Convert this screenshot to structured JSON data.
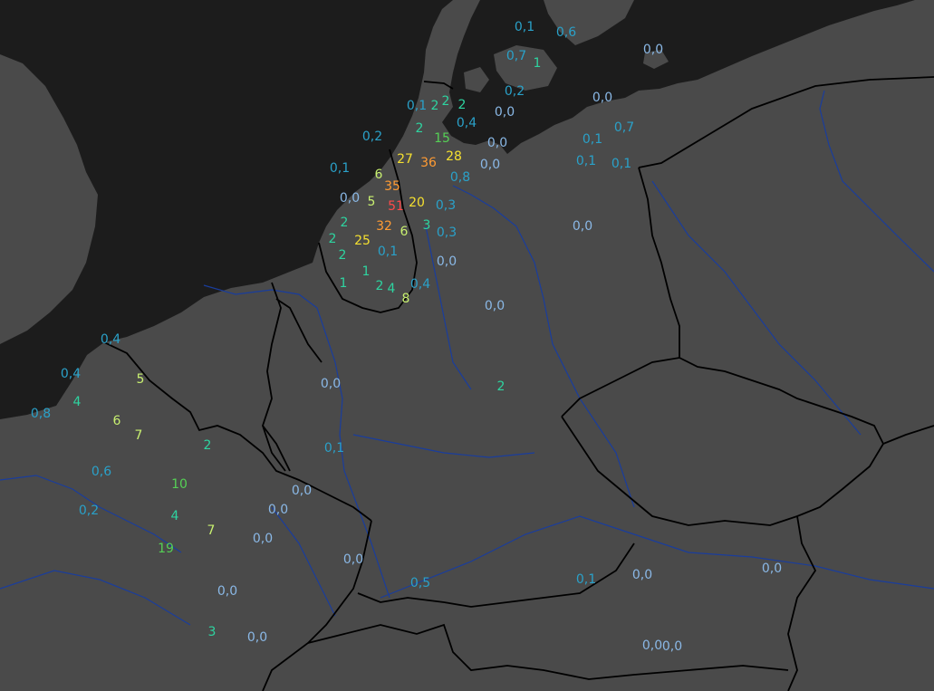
{
  "colors": {
    "sea": "#1c1c1c",
    "land": "#4a4a4a",
    "border": "#000000",
    "river": "#1a3d9c",
    "value_colors": {
      "zero": "#8ab8e6",
      "low": "#2aa1c9",
      "small": "#2ed4a0",
      "moderate": "#55d055",
      "medium": "#c8f070",
      "high": "#f5e030",
      "very_high": "#ff9b33",
      "extreme": "#ff4a4a"
    }
  },
  "labels": [
    {
      "text": "0,1",
      "cls": "low"
    },
    {
      "text": "0,6",
      "cls": "low"
    },
    {
      "text": "0,7",
      "cls": "low"
    },
    {
      "text": "1",
      "cls": "small"
    },
    {
      "text": "0,0",
      "cls": "zero"
    },
    {
      "text": "0,2",
      "cls": "low"
    },
    {
      "text": "0,0",
      "cls": "zero"
    },
    {
      "text": "0,1",
      "cls": "low"
    },
    {
      "text": "2",
      "cls": "small"
    },
    {
      "text": "2",
      "cls": "small"
    },
    {
      "text": "2",
      "cls": "small"
    },
    {
      "text": "0,0",
      "cls": "zero"
    },
    {
      "text": "0,4",
      "cls": "low"
    },
    {
      "text": "2",
      "cls": "small"
    },
    {
      "text": "0,7",
      "cls": "low"
    },
    {
      "text": "0,2",
      "cls": "low"
    },
    {
      "text": "15",
      "cls": "moderate"
    },
    {
      "text": "0,0",
      "cls": "zero"
    },
    {
      "text": "0,1",
      "cls": "low"
    },
    {
      "text": "0,1",
      "cls": "low"
    },
    {
      "text": "0,1",
      "cls": "low"
    },
    {
      "text": "27",
      "cls": "high"
    },
    {
      "text": "36",
      "cls": "very_high"
    },
    {
      "text": "28",
      "cls": "high"
    },
    {
      "text": "0,0",
      "cls": "zero"
    },
    {
      "text": "0,1",
      "cls": "low"
    },
    {
      "text": "6",
      "cls": "medium"
    },
    {
      "text": "35",
      "cls": "very_high"
    },
    {
      "text": "0,8",
      "cls": "low"
    },
    {
      "text": "0,0",
      "cls": "zero"
    },
    {
      "text": "5",
      "cls": "medium"
    },
    {
      "text": "51",
      "cls": "extreme"
    },
    {
      "text": "20",
      "cls": "high"
    },
    {
      "text": "0,3",
      "cls": "low"
    },
    {
      "text": "2",
      "cls": "small"
    },
    {
      "text": "32",
      "cls": "very_high"
    },
    {
      "text": "3",
      "cls": "small"
    },
    {
      "text": "0,0",
      "cls": "zero"
    },
    {
      "text": "2",
      "cls": "small"
    },
    {
      "text": "25",
      "cls": "high"
    },
    {
      "text": "6",
      "cls": "medium"
    },
    {
      "text": "0,3",
      "cls": "low"
    },
    {
      "text": "2",
      "cls": "small"
    },
    {
      "text": "0,1",
      "cls": "low"
    },
    {
      "text": "0,0",
      "cls": "zero"
    },
    {
      "text": "1",
      "cls": "small"
    },
    {
      "text": "1",
      "cls": "small"
    },
    {
      "text": "2",
      "cls": "small"
    },
    {
      "text": "4",
      "cls": "small"
    },
    {
      "text": "0,4",
      "cls": "low"
    },
    {
      "text": "8",
      "cls": "medium"
    },
    {
      "text": "0,0",
      "cls": "zero"
    },
    {
      "text": "0,4",
      "cls": "low"
    },
    {
      "text": "0,4",
      "cls": "low"
    },
    {
      "text": "5",
      "cls": "medium"
    },
    {
      "text": "0,0",
      "cls": "zero"
    },
    {
      "text": "4",
      "cls": "small"
    },
    {
      "text": "2",
      "cls": "small"
    },
    {
      "text": "0,8",
      "cls": "low"
    },
    {
      "text": "6",
      "cls": "medium"
    },
    {
      "text": "7",
      "cls": "medium"
    },
    {
      "text": "2",
      "cls": "small"
    },
    {
      "text": "0,1",
      "cls": "low"
    },
    {
      "text": "0,6",
      "cls": "low"
    },
    {
      "text": "10",
      "cls": "moderate"
    },
    {
      "text": "0,0",
      "cls": "zero"
    },
    {
      "text": "0,0",
      "cls": "zero"
    },
    {
      "text": "0,2",
      "cls": "low"
    },
    {
      "text": "4",
      "cls": "small"
    },
    {
      "text": "7",
      "cls": "medium"
    },
    {
      "text": "0,0",
      "cls": "zero"
    },
    {
      "text": "19",
      "cls": "moderate"
    },
    {
      "text": "0,0",
      "cls": "zero"
    },
    {
      "text": "0,1",
      "cls": "low"
    },
    {
      "text": "0,0",
      "cls": "zero"
    },
    {
      "text": "0,0",
      "cls": "zero"
    },
    {
      "text": "0,5",
      "cls": "low"
    },
    {
      "text": "0,0",
      "cls": "zero"
    },
    {
      "text": "3",
      "cls": "small"
    },
    {
      "text": "0,0",
      "cls": "zero"
    },
    {
      "text": "0,0",
      "cls": "zero"
    },
    {
      "text": "0,0",
      "cls": "zero"
    }
  ]
}
